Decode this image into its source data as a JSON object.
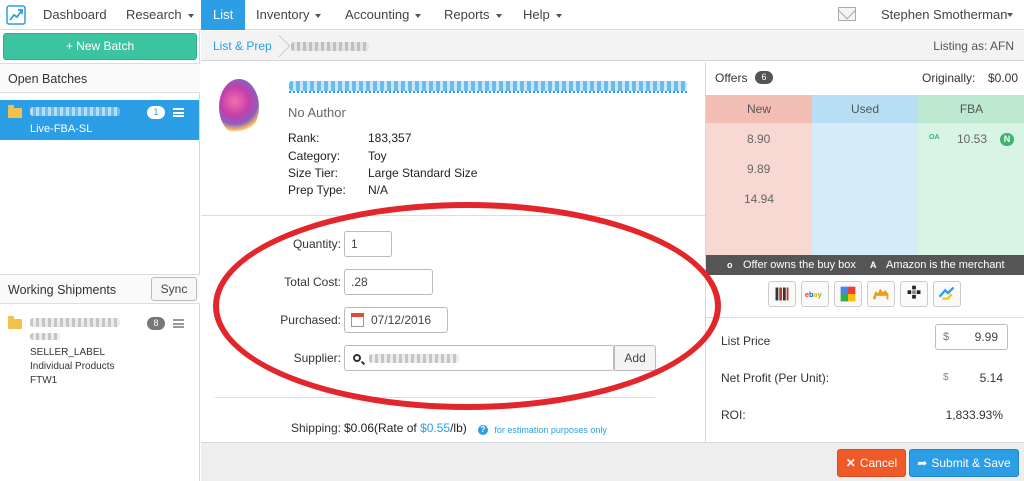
{
  "nav": {
    "items": [
      {
        "label": "Dashboard"
      },
      {
        "label": "Research"
      },
      {
        "label": "List"
      },
      {
        "label": "Inventory"
      },
      {
        "label": "Accounting"
      },
      {
        "label": "Reports"
      },
      {
        "label": "Help"
      }
    ],
    "user_name": "Stephen Smotherman"
  },
  "sidebar": {
    "new_batch_label": "+ New Batch",
    "open_batches_title": "Open Batches",
    "batch": {
      "name": "Live-FBA-SL",
      "count": "1"
    },
    "working_shipments_title": "Working Shipments",
    "sync_label": "Sync",
    "shipment": {
      "count": "8",
      "line1": "SELLER_LABEL",
      "line2": "Individual Products",
      "line3": "FTW1"
    }
  },
  "breadcrumb": {
    "first": "List & Prep",
    "listing_as": "Listing as: AFN"
  },
  "product": {
    "author": "No Author",
    "rank_label": "Rank:",
    "rank": "183,357",
    "category_label": "Category:",
    "category": "Toy",
    "size_tier_label": "Size Tier:",
    "size_tier": "Large Standard Size",
    "prep_type_label": "Prep Type:",
    "prep_type": "N/A"
  },
  "form": {
    "quantity_label": "Quantity:",
    "quantity": "1",
    "total_cost_label": "Total Cost:",
    "total_cost": ".28",
    "purchased_label": "Purchased:",
    "purchased": "07/12/2016",
    "supplier_label": "Supplier:",
    "add_label": "Add",
    "shipping_label": "Shipping:",
    "shipping_value": "$0.06(Rate of ",
    "shipping_rate": "$0.55",
    "shipping_unit": "/lb)",
    "estimation_note": "for estimation purposes only"
  },
  "offers": {
    "title": "Offers",
    "count": "6",
    "originally_label": "Originally:",
    "originally_value": "$0.00",
    "columns": [
      {
        "name": "New",
        "values": [
          "8.90",
          "9.89",
          "14.94"
        ]
      },
      {
        "name": "Used",
        "values": []
      },
      {
        "name": "FBA",
        "values": [
          "10.53"
        ],
        "badge": "N",
        "prefix": "OA"
      }
    ],
    "legend_buybox": "Offer owns the buy box",
    "legend_amazon": "Amazon is the merchant",
    "legend_o": "o",
    "legend_a": "A"
  },
  "pricing": {
    "list_price_label": "List Price",
    "currency": "$",
    "list_price": "9.99",
    "net_profit_label": "Net Profit (Per Unit):",
    "net_profit": "5.14",
    "roi_label": "ROI:",
    "roi": "1,833.93%"
  },
  "footer": {
    "cancel_label": "Cancel",
    "submit_label": "Submit & Save"
  },
  "colors": {
    "accent": "#2b9ee6",
    "new_batch": "#3cc4a0",
    "cancel": "#ef5a28",
    "new_col": "#f7d8d3",
    "used_col": "#d5ecf8",
    "fba_col": "#d8f4e4",
    "annotation": "#e3262b"
  }
}
